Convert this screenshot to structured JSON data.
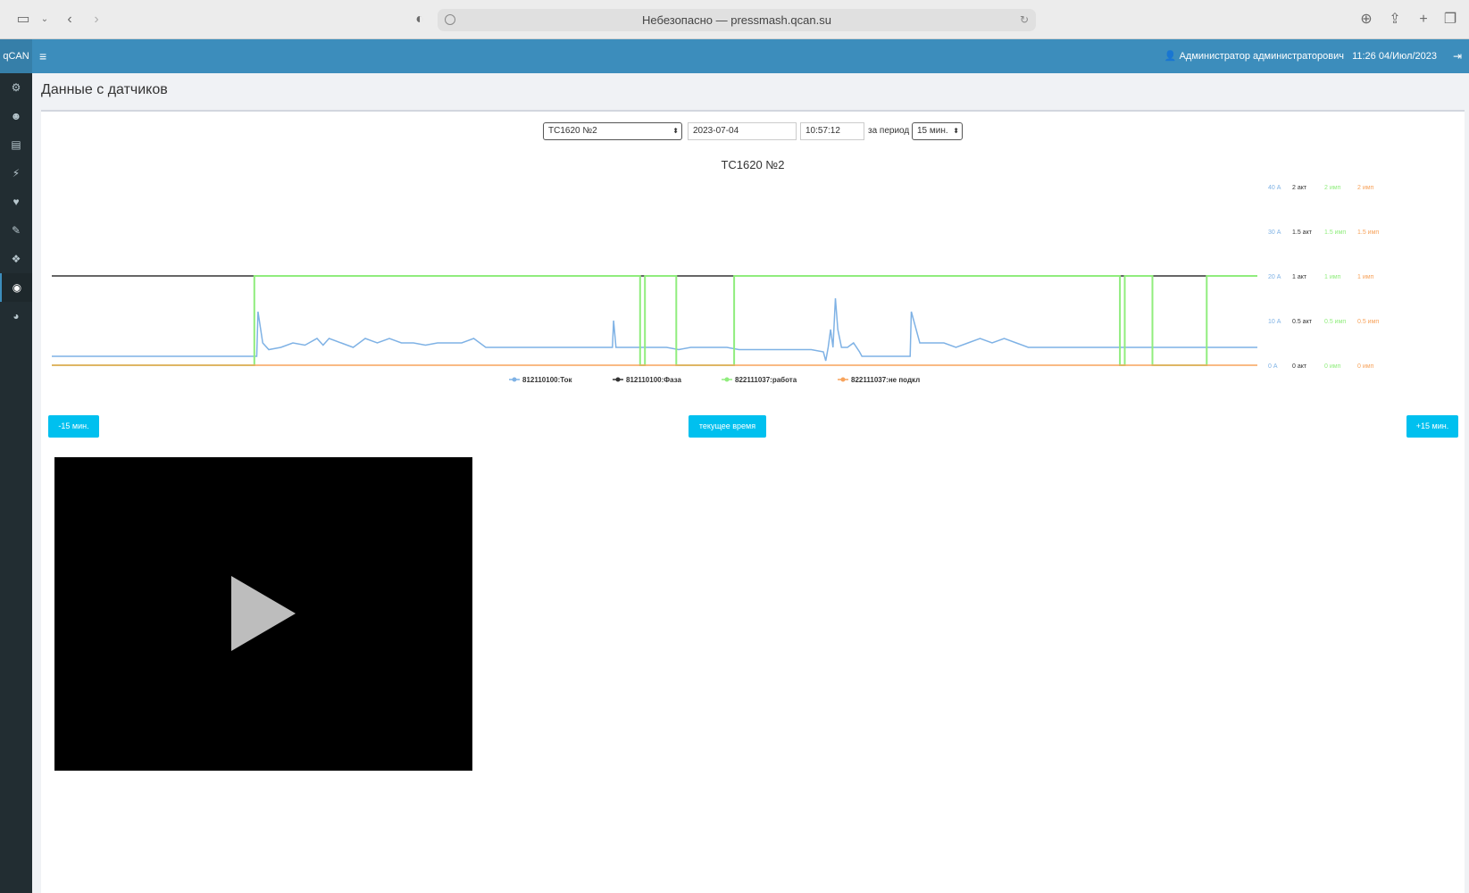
{
  "browser": {
    "url_text": "Небезопасно — pressmash.qcan.su"
  },
  "header": {
    "logo": "qCAN",
    "user": "Администратор администраторович",
    "datetime": "11:26 04/Июл/2023"
  },
  "page": {
    "title": "Данные с датчиков"
  },
  "controls": {
    "device_selected": "ТС1620 №2",
    "date_value": "2023-07-04",
    "time_value": "10:57:12",
    "period_label": "за период",
    "period_selected": "15 мин."
  },
  "buttons": {
    "back": "-15 мин.",
    "now": "текущее время",
    "forward": "+15 мин."
  },
  "colors": {
    "tok": "#7fb2e5",
    "faza": "#333333",
    "rabota": "#90ed7d",
    "nepodkl": "#f7a35c",
    "accent": "#3c8dbc",
    "button": "#00c0ef"
  },
  "chart_data": {
    "type": "line",
    "title": "ТС1620 №2",
    "x_range": [
      0,
      1
    ],
    "axes": [
      {
        "name": "current",
        "ticks": [
          "0 А",
          "10 А",
          "20 А",
          "30 А",
          "40 А"
        ],
        "range": [
          0,
          40
        ],
        "color": "#7fb2e5"
      },
      {
        "name": "phase",
        "ticks": [
          "0 акт",
          "0.5 акт",
          "1 акт",
          "1.5 акт",
          "2 акт"
        ],
        "range": [
          0,
          2
        ],
        "color": "#333333"
      },
      {
        "name": "work",
        "ticks": [
          "0 имп",
          "0.5 имп",
          "1 имп",
          "1.5 имп",
          "2 имп"
        ],
        "range": [
          0,
          2
        ],
        "color": "#90ed7d"
      },
      {
        "name": "notconn",
        "ticks": [
          "0 имп",
          "0.5 имп",
          "1 имп",
          "1.5 имп",
          "2 имп"
        ],
        "range": [
          0,
          2
        ],
        "color": "#f7a35c"
      }
    ],
    "series": [
      {
        "name": "812110100:Ток",
        "axis": "current",
        "color": "#7fb2e5",
        "points": [
          [
            0,
            2
          ],
          [
            0.168,
            2
          ],
          [
            0.17,
            2
          ],
          [
            0.171,
            12
          ],
          [
            0.175,
            5
          ],
          [
            0.18,
            3.5
          ],
          [
            0.19,
            4
          ],
          [
            0.2,
            5
          ],
          [
            0.21,
            4.5
          ],
          [
            0.22,
            6
          ],
          [
            0.225,
            4.5
          ],
          [
            0.23,
            6
          ],
          [
            0.24,
            5
          ],
          [
            0.25,
            4
          ],
          [
            0.26,
            6
          ],
          [
            0.27,
            5
          ],
          [
            0.28,
            6
          ],
          [
            0.29,
            5
          ],
          [
            0.3,
            5
          ],
          [
            0.31,
            4.5
          ],
          [
            0.32,
            5
          ],
          [
            0.33,
            5
          ],
          [
            0.34,
            5
          ],
          [
            0.35,
            6
          ],
          [
            0.36,
            4
          ],
          [
            0.37,
            4
          ],
          [
            0.38,
            4
          ],
          [
            0.39,
            4
          ],
          [
            0.4,
            4
          ],
          [
            0.41,
            4
          ],
          [
            0.42,
            4
          ],
          [
            0.43,
            4
          ],
          [
            0.44,
            4
          ],
          [
            0.45,
            4
          ],
          [
            0.465,
            4
          ],
          [
            0.466,
            10
          ],
          [
            0.468,
            4
          ],
          [
            0.48,
            4
          ],
          [
            0.5,
            4
          ],
          [
            0.51,
            4
          ],
          [
            0.52,
            3.5
          ],
          [
            0.53,
            4
          ],
          [
            0.55,
            4
          ],
          [
            0.56,
            4
          ],
          [
            0.57,
            3.5
          ],
          [
            0.6,
            3.5
          ],
          [
            0.63,
            3.5
          ],
          [
            0.64,
            3
          ],
          [
            0.642,
            1
          ],
          [
            0.644,
            4
          ],
          [
            0.646,
            8
          ],
          [
            0.648,
            4
          ],
          [
            0.65,
            15
          ],
          [
            0.652,
            8
          ],
          [
            0.655,
            4
          ],
          [
            0.66,
            4
          ],
          [
            0.665,
            5
          ],
          [
            0.67,
            3
          ],
          [
            0.672,
            2
          ],
          [
            0.7,
            2
          ],
          [
            0.712,
            2
          ],
          [
            0.713,
            12
          ],
          [
            0.72,
            5
          ],
          [
            0.73,
            5
          ],
          [
            0.74,
            5
          ],
          [
            0.75,
            4
          ],
          [
            0.76,
            5
          ],
          [
            0.77,
            6
          ],
          [
            0.78,
            5
          ],
          [
            0.79,
            6
          ],
          [
            0.8,
            5
          ],
          [
            0.81,
            4
          ],
          [
            0.82,
            4
          ],
          [
            0.83,
            4
          ],
          [
            0.84,
            4
          ],
          [
            0.85,
            4
          ],
          [
            0.86,
            4
          ],
          [
            0.87,
            4
          ],
          [
            0.88,
            4
          ],
          [
            0.89,
            4
          ],
          [
            0.9,
            4
          ],
          [
            0.91,
            4
          ],
          [
            0.92,
            4
          ],
          [
            0.93,
            4
          ],
          [
            0.94,
            4
          ],
          [
            0.95,
            4
          ],
          [
            0.96,
            4
          ],
          [
            0.97,
            4
          ],
          [
            0.98,
            4
          ],
          [
            0.99,
            4
          ],
          [
            1,
            4
          ]
        ]
      },
      {
        "name": "812110100:Фаза",
        "axis": "phase",
        "color": "#333333",
        "points": [
          [
            0,
            1
          ],
          [
            1,
            1
          ]
        ]
      },
      {
        "name": "822111037:работа",
        "axis": "work",
        "color": "#90ed7d",
        "points": [
          [
            0,
            0
          ],
          [
            0.168,
            0
          ],
          [
            0.168,
            1
          ],
          [
            0.488,
            1
          ],
          [
            0.488,
            0
          ],
          [
            0.492,
            0
          ],
          [
            0.492,
            1
          ],
          [
            0.518,
            1
          ],
          [
            0.518,
            0
          ],
          [
            0.566,
            0
          ],
          [
            0.566,
            1
          ],
          [
            0.886,
            1
          ],
          [
            0.886,
            0
          ],
          [
            0.89,
            0
          ],
          [
            0.89,
            1
          ],
          [
            0.913,
            1
          ],
          [
            0.913,
            0
          ],
          [
            0.958,
            0
          ],
          [
            0.958,
            1
          ],
          [
            1,
            1
          ]
        ]
      },
      {
        "name": "822111037:не подкл",
        "axis": "notconn",
        "color": "#f7a35c",
        "points": [
          [
            0,
            0
          ],
          [
            1,
            0
          ]
        ]
      }
    ]
  }
}
